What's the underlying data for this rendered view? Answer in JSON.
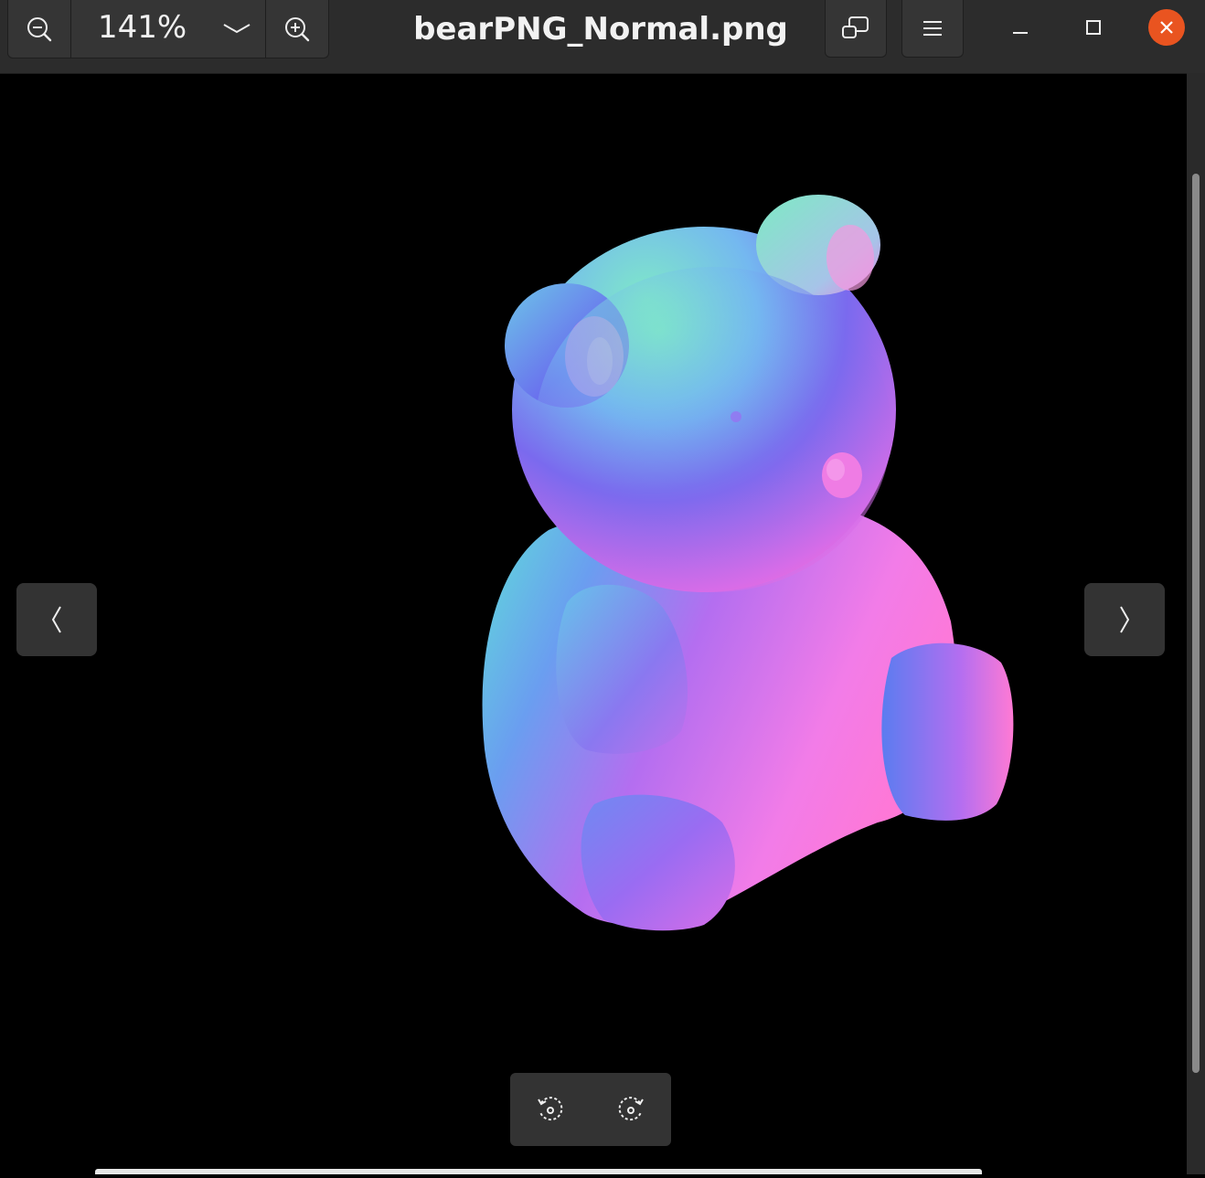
{
  "header": {
    "zoom_level": "141%",
    "title": "bearPNG_Normal.png"
  },
  "icons": {
    "zoom_out": "zoom-out-icon",
    "zoom_dropdown": "chevron-down-icon",
    "zoom_in": "zoom-in-icon",
    "gallery": "gallery-icon",
    "menu": "hamburger-menu-icon",
    "minimize": "minimize-icon",
    "maximize": "maximize-icon",
    "close": "close-icon",
    "previous": "chevron-left-icon",
    "next": "chevron-right-icon",
    "rotate_left": "rotate-left-icon",
    "rotate_right": "rotate-right-icon"
  },
  "colors": {
    "headerbar": "#2c2c2c",
    "button": "#353535",
    "close_accent": "#e95420",
    "canvas": "#000000"
  },
  "image": {
    "subject": "teddy bear normal map"
  }
}
